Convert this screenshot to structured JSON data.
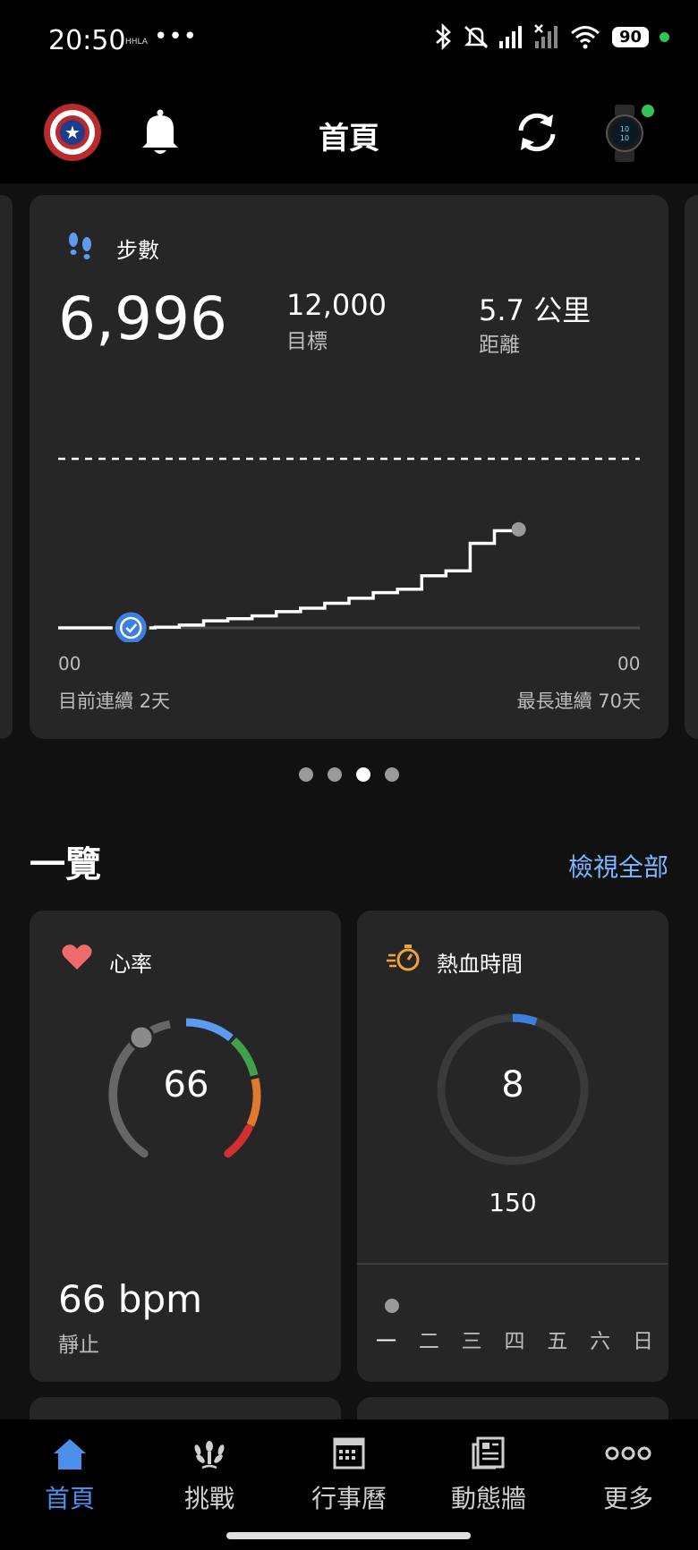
{
  "status_bar": {
    "time": "20:50",
    "carrier_badge": "HHLA",
    "more": "•••",
    "battery": "90",
    "icons": [
      "bluetooth-icon",
      "bell-muted-icon",
      "signal-icon",
      "signal-no-service-icon",
      "wifi-icon"
    ]
  },
  "header": {
    "title": "首頁",
    "left_icons": [
      "avatar-shield-icon",
      "bell-icon"
    ],
    "right_icons": [
      "sync-icon",
      "watch-icon"
    ]
  },
  "steps_card": {
    "label": "步數",
    "value": "6,996",
    "goal_value": "12,000",
    "goal_label": "目標",
    "distance_value": "5.7 公里",
    "distance_label": "距離",
    "x_start": "00",
    "x_end": "00",
    "current_streak": "目前連續 2天",
    "longest_streak": "最長連續 70天",
    "accent_color": "#5b9bf0"
  },
  "chart_data": {
    "type": "line",
    "title": "",
    "xlabel": "",
    "ylabel": "",
    "x_tick_labels": [
      "00",
      "00"
    ],
    "ylim": [
      0,
      12000
    ],
    "goal": 12000,
    "series": [
      {
        "values": [
          [
            0,
            0
          ],
          [
            2,
            0
          ],
          [
            3,
            0
          ],
          [
            4,
            50
          ],
          [
            5,
            200
          ],
          [
            6,
            500
          ],
          [
            7,
            650
          ],
          [
            8,
            850
          ],
          [
            9,
            1150
          ],
          [
            10,
            1400
          ],
          [
            11,
            1750
          ],
          [
            12,
            2100
          ],
          [
            13,
            2500
          ],
          [
            14,
            2750
          ],
          [
            15,
            3700
          ],
          [
            16,
            4050
          ],
          [
            17,
            6000
          ],
          [
            18,
            6900
          ],
          [
            19,
            6996
          ]
        ]
      }
    ],
    "marker_hour": 3
  },
  "pager": {
    "count": 4,
    "active": 2
  },
  "overview": {
    "title": "一覽",
    "view_all": "檢視全部"
  },
  "heart_rate": {
    "label": "心率",
    "gauge_value": "66",
    "value": "66 bpm",
    "sub": "靜止",
    "gauge_colors": [
      "#666666",
      "#5b9bf0",
      "#3fa14a",
      "#e0782f",
      "#d2302d"
    ]
  },
  "intensity": {
    "label": "熱血時間",
    "value": "8",
    "goal": "150",
    "progress_fraction": 0.053,
    "weekdays": [
      "一",
      "二",
      "三",
      "四",
      "五",
      "六",
      "日"
    ]
  },
  "bottom_nav": [
    {
      "label": "首頁",
      "icon": "home-icon",
      "active": true
    },
    {
      "label": "挑戰",
      "icon": "laurel-icon",
      "active": false
    },
    {
      "label": "行事曆",
      "icon": "calendar-icon",
      "active": false
    },
    {
      "label": "動態牆",
      "icon": "newsfeed-icon",
      "active": false
    },
    {
      "label": "更多",
      "icon": "more-icon",
      "active": false
    }
  ]
}
